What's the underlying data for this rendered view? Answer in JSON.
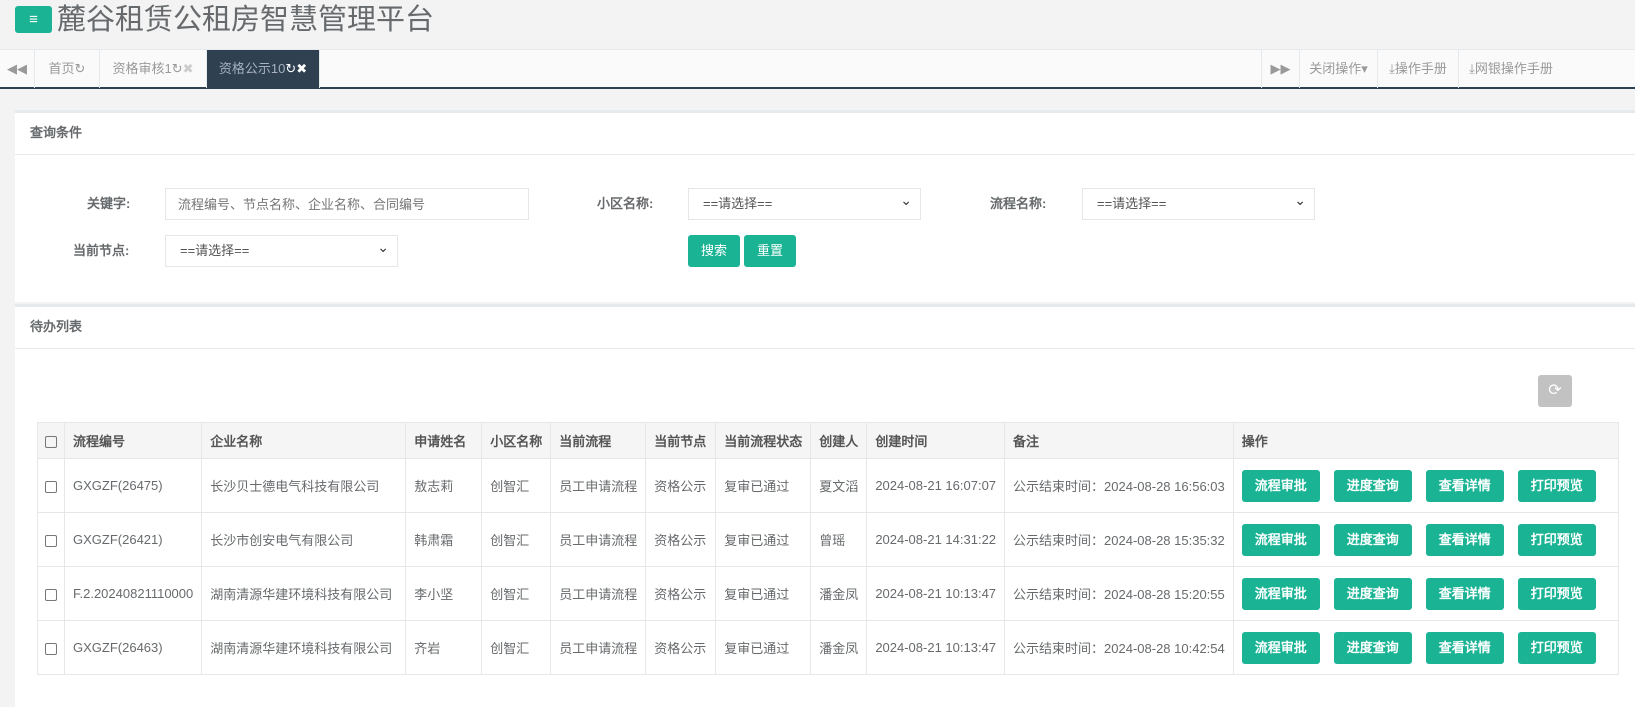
{
  "header": {
    "title": "麓谷租赁公租房智慧管理平台",
    "menu_icon": "≡"
  },
  "tabs": [
    {
      "label": "首页"
    },
    {
      "label": "资格审核1"
    },
    {
      "label": "资格公示10"
    }
  ],
  "toolbar": {
    "close_ops": "关闭操作",
    "manual": "操作手册",
    "bank_manual": "网银操作手册"
  },
  "query": {
    "title": "查询条件",
    "keyword_label": "关键字:",
    "keyword_placeholder": "流程编号、节点名称、企业名称、合同编号",
    "community_label": "小区名称:",
    "community_value": "==请选择==",
    "flow_label": "流程名称:",
    "flow_value": "==请选择==",
    "node_label": "当前节点:",
    "node_value": "==请选择==",
    "search": "搜索",
    "reset": "重置"
  },
  "list": {
    "title": "待办列表",
    "columns": [
      "流程编号",
      "企业名称",
      "申请姓名",
      "小区名称",
      "当前流程",
      "当前节点",
      "当前流程状态",
      "创建人",
      "创建时间",
      "备注",
      "操作"
    ],
    "actions": [
      "流程审批",
      "进度查询",
      "查看详情",
      "打印预览"
    ],
    "rows": [
      [
        "GXGZF(26475)",
        "长沙贝士德电气科技有限公司",
        "敖志莉",
        "创智汇",
        "员工申请流程",
        "资格公示",
        "复审已通过",
        "夏文滔",
        "2024-08-21 16:07:07",
        "公示结束时间：2024-08-28 16:56:03"
      ],
      [
        "GXGZF(26421)",
        "长沙市创安电气有限公司",
        "韩肃霜",
        "创智汇",
        "员工申请流程",
        "资格公示",
        "复审已通过",
        "曾瑶",
        "2024-08-21 14:31:22",
        "公示结束时间：2024-08-28 15:35:32"
      ],
      [
        "F.2.20240821110000",
        "湖南清源华建环境科技有限公司",
        "李小坚",
        "创智汇",
        "员工申请流程",
        "资格公示",
        "复审已通过",
        "潘金凤",
        "2024-08-21 10:13:47",
        "公示结束时间：2024-08-28 15:20:55"
      ],
      [
        "GXGZF(26463)",
        "湖南清源华建环境科技有限公司",
        "齐岩",
        "创智汇",
        "员工申请流程",
        "资格公示",
        "复审已通过",
        "潘金凤",
        "2024-08-21 10:13:47",
        "公示结束时间：2024-08-28 10:42:54"
      ]
    ]
  }
}
